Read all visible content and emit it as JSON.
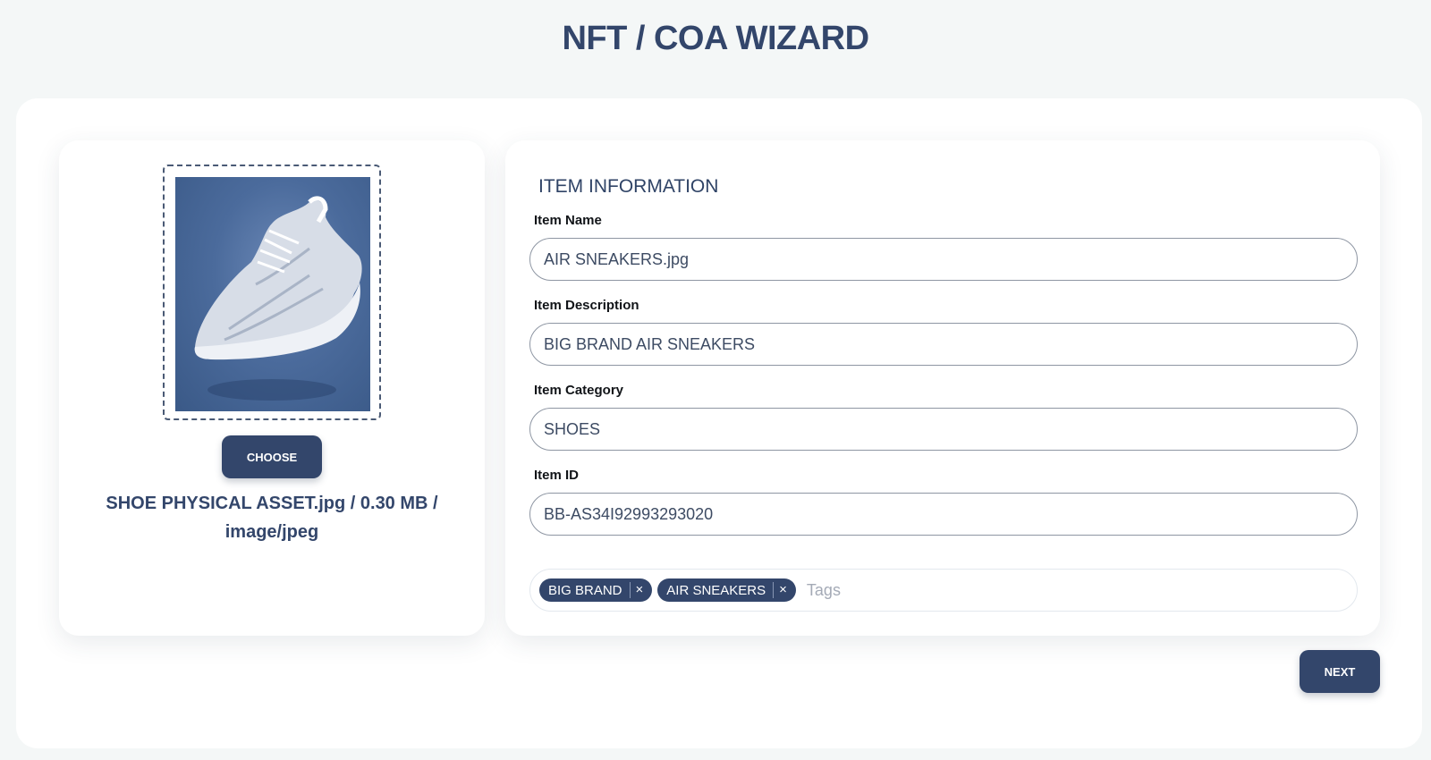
{
  "page": {
    "title": "NFT / COA WIZARD"
  },
  "asset": {
    "image_icon": "sneaker-photo",
    "choose_label": "CHOOSE",
    "file_info": "SHOE PHYSICAL ASSET.jpg / 0.30 MB / image/jpeg"
  },
  "item_info": {
    "section_title": "ITEM INFORMATION",
    "fields": [
      {
        "label": "Item Name",
        "value": "AIR SNEAKERS.jpg"
      },
      {
        "label": "Item Description",
        "value": "BIG BRAND AIR SNEAKERS"
      },
      {
        "label": "Item Category",
        "value": "SHOES"
      },
      {
        "label": "Item ID",
        "value": "BB-AS34I92993293020"
      }
    ],
    "tags": {
      "items": [
        {
          "label": "BIG BRAND",
          "remove": "×"
        },
        {
          "label": "AIR SNEAKERS",
          "remove": "×"
        }
      ],
      "placeholder": "Tags"
    }
  },
  "footer": {
    "next_label": "NEXT"
  },
  "colors": {
    "accent": "#33466b",
    "background": "#f4f7f7",
    "card": "#ffffff"
  }
}
